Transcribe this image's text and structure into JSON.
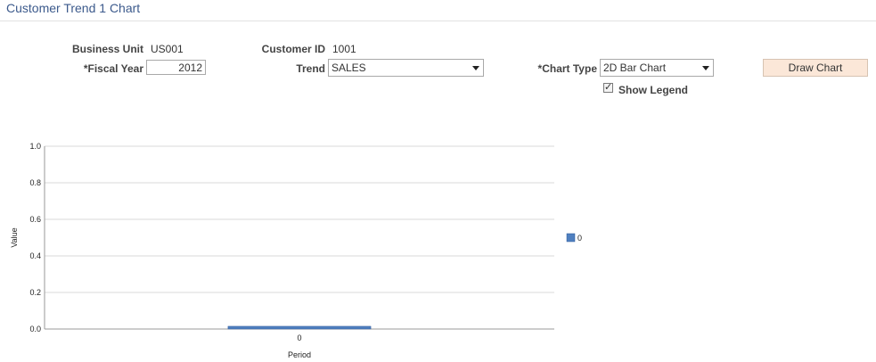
{
  "page": {
    "title": "Customer Trend 1 Chart"
  },
  "form": {
    "business_unit_label": "Business Unit",
    "business_unit_value": "US001",
    "customer_id_label": "Customer ID",
    "customer_id_value": "1001",
    "fiscal_year_label": "*Fiscal Year",
    "fiscal_year_value": "2012",
    "trend_label": "Trend",
    "trend_value": "SALES",
    "chart_type_label": "*Chart Type",
    "chart_type_value": "2D Bar Chart",
    "draw_chart_label": "Draw Chart",
    "show_legend_label": "Show Legend",
    "show_legend_checked": true
  },
  "chart_data": {
    "type": "bar",
    "categories": [
      "0"
    ],
    "series": [
      {
        "name": "0",
        "values": [
          0.01
        ],
        "color": "#4f7fbf"
      }
    ],
    "xlabel": "Period",
    "ylabel": "Value",
    "ylim": [
      0,
      1.0
    ],
    "yticks": [
      "0.0",
      "0.2",
      "0.4",
      "0.6",
      "0.8",
      "1.0"
    ],
    "grid": true,
    "legend_position": "right",
    "legend_label": "0"
  }
}
